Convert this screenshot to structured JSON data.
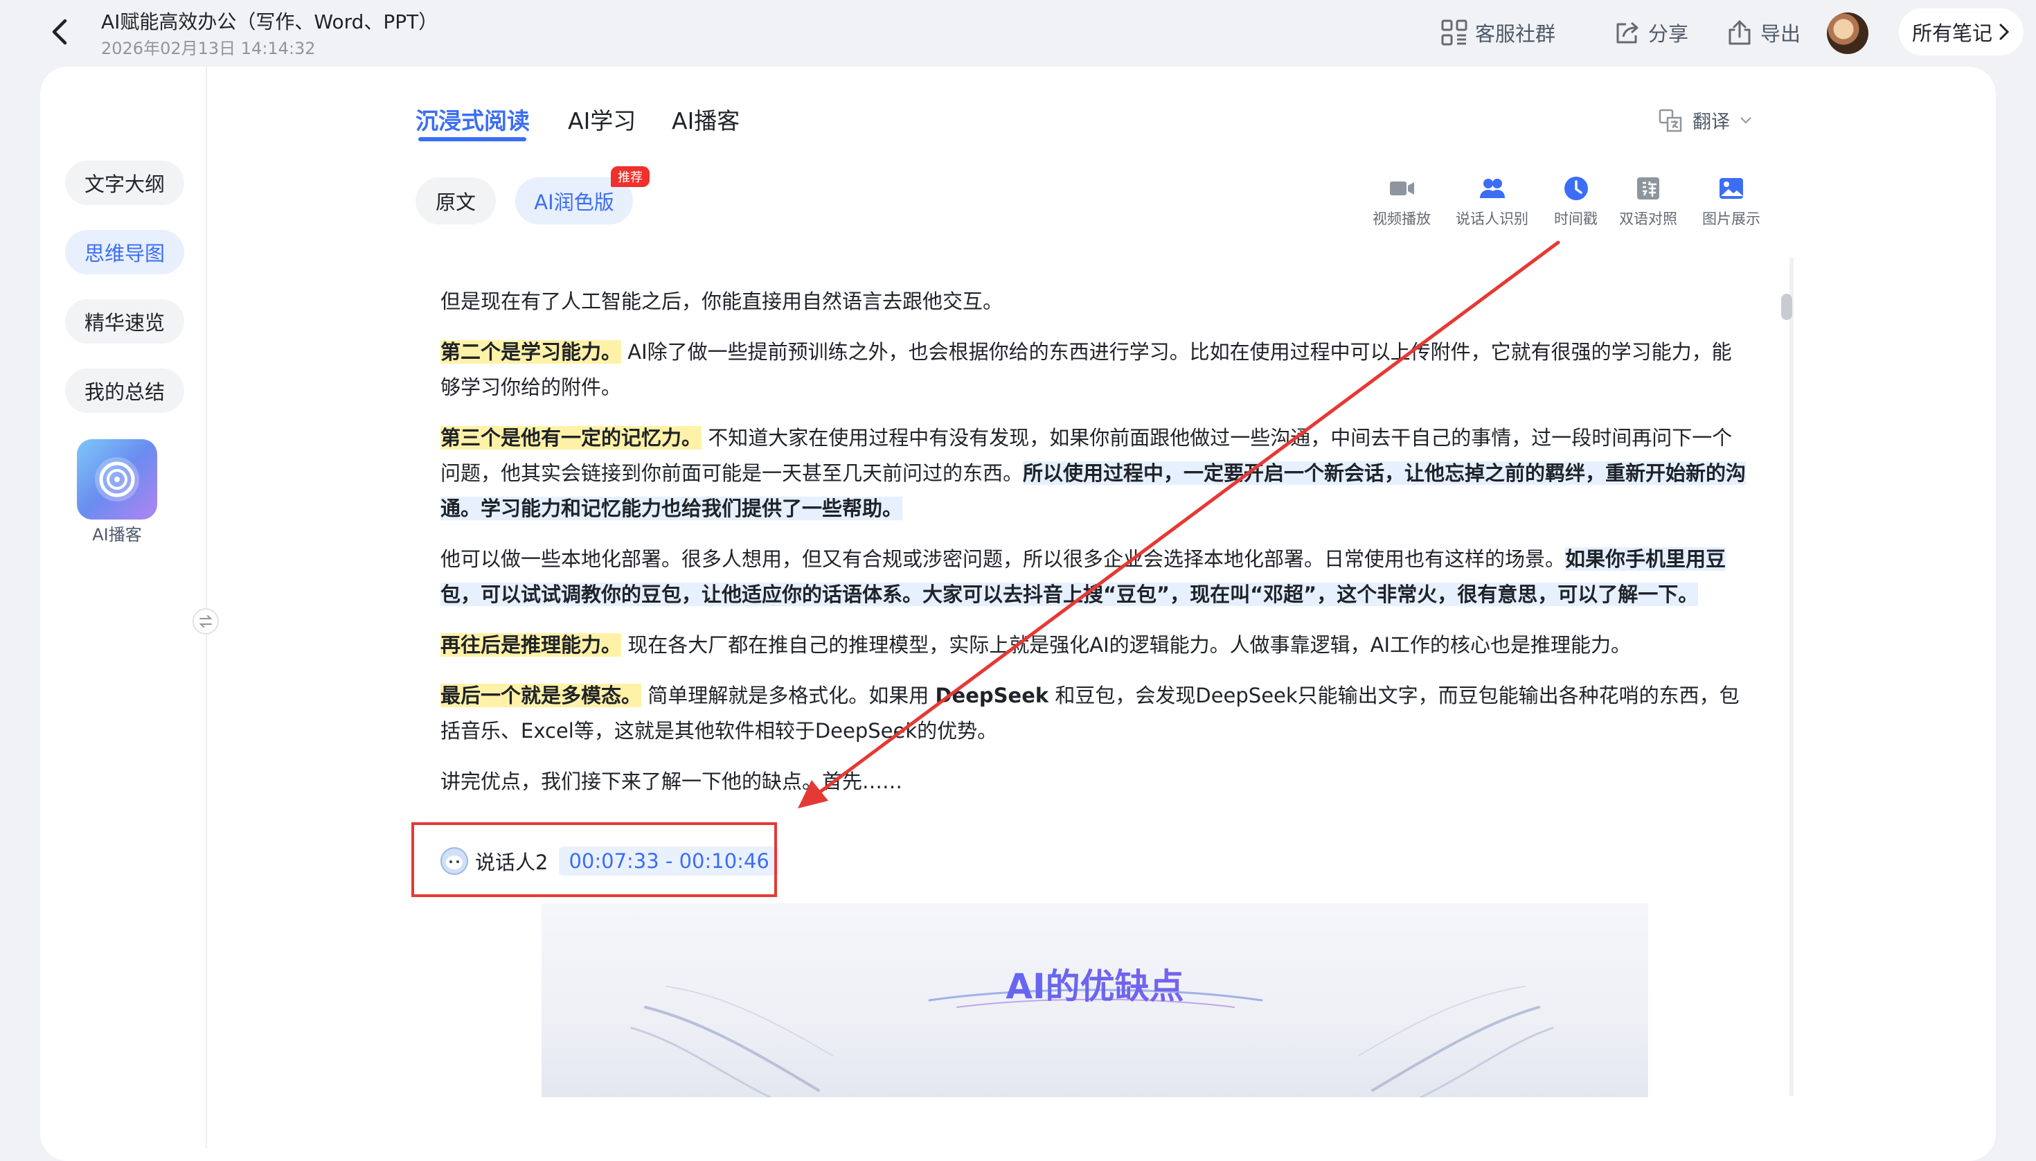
{
  "header": {
    "title": "AI赋能高效办公（写作、Word、PPT）",
    "date": "2026年02月13日 14:14:32",
    "service_group": "客服社群",
    "share": "分享",
    "export": "导出",
    "all_notes": "所有笔记"
  },
  "sidebar": {
    "items": [
      {
        "label": "文字大纲"
      },
      {
        "label": "思维导图"
      },
      {
        "label": "精华速览"
      },
      {
        "label": "我的总结"
      }
    ],
    "active_index": 1,
    "podcast_label": "AI播客"
  },
  "tabs": {
    "items": [
      {
        "label": "沉浸式阅读"
      },
      {
        "label": "AI学习"
      },
      {
        "label": "AI播客"
      }
    ],
    "active_index": 0,
    "translate": "翻译"
  },
  "version": {
    "original": "原文",
    "ai_polished": "AI润色版",
    "badge": "推荐"
  },
  "tools": [
    {
      "label": "视频播放",
      "icon": "video-icon"
    },
    {
      "label": "说话人识别",
      "icon": "speakers-icon"
    },
    {
      "label": "时间戳",
      "icon": "clock-icon"
    },
    {
      "label": "双语对照",
      "icon": "bilingual-icon"
    },
    {
      "label": "图片展示",
      "icon": "image-icon"
    }
  ],
  "content": {
    "p1": "但是现在有了人工智能之后，你能直接用自然语言去跟他交互。",
    "p2_hl": "第二个是学习能力。",
    "p2_text": "AI除了做一些提前预训练之外，也会根据你给的东西进行学习。比如在使用过程中可以上传附件，它就有很强的学习能力，能够学习你给的附件。",
    "p3_hl": "第三个是他有一定的记忆力。",
    "p3_text": "不知道大家在使用过程中有没有发现，如果你前面跟他做过一些沟通，中间去干自己的事情，过一段时间再问下一个问题，他其实会链接到你前面可能是一天甚至几天前问过的东西。",
    "p3_hl2": "所以使用过程中，一定要开启一个新会话，让他忘掉之前的羁绊，重新开始新的沟通。学习能力和记忆能力也给我们提供了一些帮助。",
    "p4_text": "他可以做一些本地化部署。很多人想用，但又有合规或涉密问题，所以很多企业会选择本地化部署。日常使用也有这样的场景。",
    "p4_hl": "如果你手机里用豆包，可以试试调教你的豆包，让他适应你的话语体系。大家可以去抖音上搜“豆包”，现在叫“邓超”，这个非常火，很有意思，可以了解一下。",
    "p5_hl": "再往后是推理能力。",
    "p5_text": "现在各大厂都在推自己的推理模型，实际上就是强化AI的逻辑能力。人做事靠逻辑，AI工作的核心也是推理能力。",
    "p6_hl": "最后一个就是多模态。",
    "p6_text_a": "简单理解就是多格式化。如果用",
    "p6_bold": "DeepSeek",
    "p6_text_b": "和豆包，会发现DeepSeek只能输出文字，而豆包能输出各种花哨的东西，包括音乐、Excel等，这就是其他软件相较于DeepSeek的优势。",
    "p7": "讲完优点，我们接下来了解一下他的缺点。首先……"
  },
  "speaker": {
    "name": "说话人2",
    "timestamp": "00:07:33 - 00:10:46"
  },
  "slide": {
    "title": "AI的优缺点"
  },
  "colors": {
    "accent": "#3b6ef5",
    "highlight_yellow": "#fff2a8",
    "highlight_blue": "#e6f0ff",
    "annotation_red": "#e53935"
  }
}
